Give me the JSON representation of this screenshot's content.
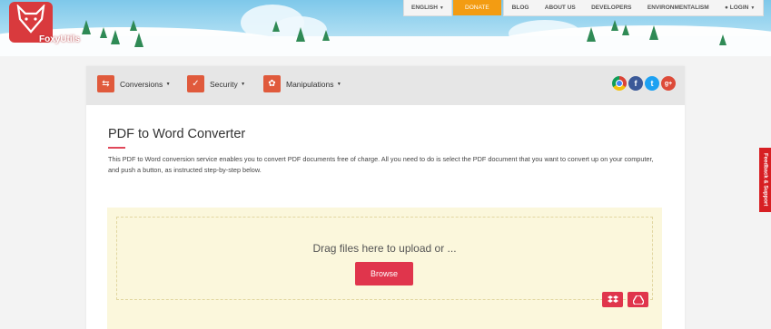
{
  "brand": {
    "name": "FoxyUtils"
  },
  "topnav": {
    "language": "ENGLISH",
    "donate": "DONATE",
    "items": [
      {
        "label": "BLOG"
      },
      {
        "label": "ABOUT US"
      },
      {
        "label": "DEVELOPERS"
      },
      {
        "label": "ENVIRONMENTALISM"
      },
      {
        "label": "LOGIN"
      }
    ]
  },
  "toolbar": {
    "menus": [
      {
        "label": "Conversions",
        "icon": "conversions-icon"
      },
      {
        "label": "Security",
        "icon": "shield-icon"
      },
      {
        "label": "Manipulations",
        "icon": "pdf-icon"
      }
    ],
    "social": [
      "chrome-icon",
      "facebook-icon",
      "twitter-icon",
      "google-plus-icon"
    ]
  },
  "page": {
    "title": "PDF to Word Converter",
    "description": "This PDF to Word conversion service enables you to convert PDF documents free of charge. All you need to do is select the PDF document that you want to convert up on your computer, and push a button, as instructed step-by-step below."
  },
  "upload": {
    "drag_text": "Drag files here to upload or ...",
    "browse_label": "Browse",
    "cloud_sources": [
      "dropbox-icon",
      "google-drive-icon"
    ]
  },
  "feedback": {
    "label": "Feedback & Support"
  },
  "colors": {
    "accent": "#e0354c",
    "donate": "#f39c12",
    "toolbar_icon": "#e05a3c",
    "dropzone_bg": "#fbf7dc"
  }
}
